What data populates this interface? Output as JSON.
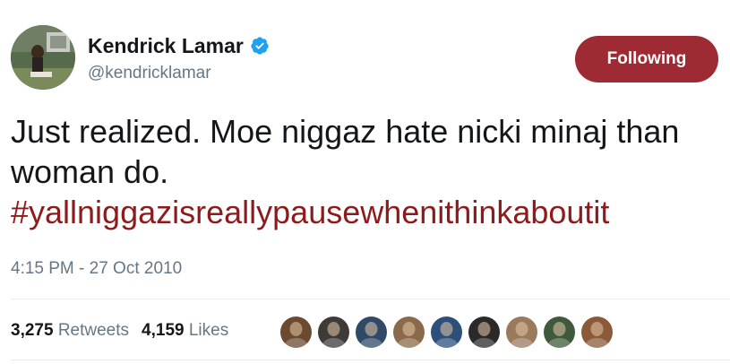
{
  "user": {
    "display_name": "Kendrick Lamar",
    "handle": "@kendricklamar",
    "verified": true,
    "avatar": "user-avatar-photo"
  },
  "follow_button": {
    "label": "Following",
    "color": "#9e2a33"
  },
  "tweet": {
    "text": "Just realized. Moe niggaz hate nicki minaj than woman do.",
    "hashtag": "#yallniggazisreallypausewhenithinkaboutit",
    "hashtag_color": "#8e1b1b",
    "timestamp": "4:15 PM - 27 Oct 2010"
  },
  "stats": {
    "retweets_count": "3,275",
    "retweets_label": "Retweets",
    "likes_count": "4,159",
    "likes_label": "Likes"
  },
  "likers": [
    {
      "color": "#6b4a2f"
    },
    {
      "color": "#3d3a38"
    },
    {
      "color": "#2f4a66"
    },
    {
      "color": "#8a6a4a"
    },
    {
      "color": "#2d4f7a"
    },
    {
      "color": "#2a2a2a"
    },
    {
      "color": "#9a7a5c"
    },
    {
      "color": "#3f5a3a"
    },
    {
      "color": "#8a5a3a"
    }
  ]
}
